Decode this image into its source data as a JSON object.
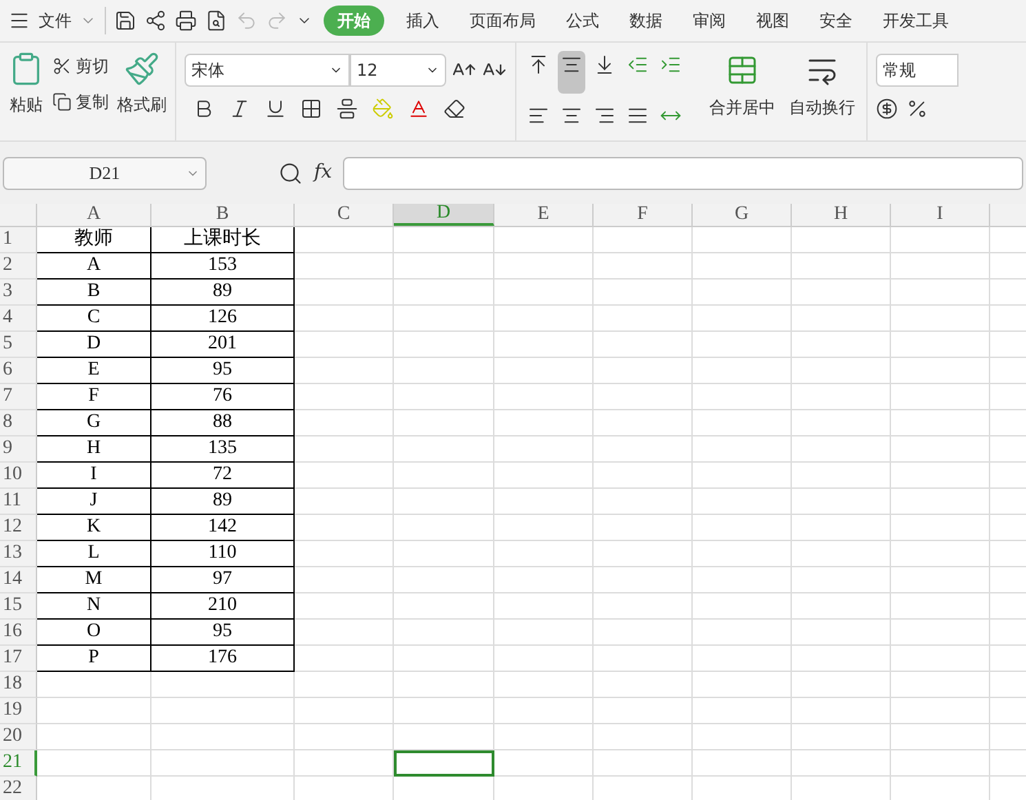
{
  "menu": {
    "file_label": "文件",
    "tabs": [
      {
        "label": "开始",
        "selected": true
      },
      {
        "label": "插入",
        "selected": false
      },
      {
        "label": "页面布局",
        "selected": false
      },
      {
        "label": "公式",
        "selected": false
      },
      {
        "label": "数据",
        "selected": false
      },
      {
        "label": "审阅",
        "selected": false
      },
      {
        "label": "视图",
        "selected": false
      },
      {
        "label": "安全",
        "selected": false
      },
      {
        "label": "开发工具",
        "selected": false
      }
    ]
  },
  "ribbon": {
    "paste": "粘贴",
    "cut": "剪切",
    "copy": "复制",
    "format_painter": "格式刷",
    "font_name": "宋体",
    "font_size": "12",
    "merge_center": "合并居中",
    "wrap_text": "自动换行",
    "number_format": "常规"
  },
  "formula_bar": {
    "name_box": "D21",
    "fx": "fx"
  },
  "sheet": {
    "columns": [
      {
        "label": "A",
        "selected": false
      },
      {
        "label": "B",
        "selected": false
      },
      {
        "label": "C",
        "selected": false
      },
      {
        "label": "D",
        "selected": true
      },
      {
        "label": "E",
        "selected": false
      },
      {
        "label": "F",
        "selected": false
      },
      {
        "label": "G",
        "selected": false
      },
      {
        "label": "H",
        "selected": false
      },
      {
        "label": "I",
        "selected": false
      }
    ],
    "rows": [
      {
        "label": "1",
        "selected": false,
        "cells": [
          "教师",
          "上课时长"
        ]
      },
      {
        "label": "2",
        "selected": false,
        "cells": [
          "A",
          "153"
        ]
      },
      {
        "label": "3",
        "selected": false,
        "cells": [
          "B",
          "89"
        ]
      },
      {
        "label": "4",
        "selected": false,
        "cells": [
          "C",
          "126"
        ]
      },
      {
        "label": "5",
        "selected": false,
        "cells": [
          "D",
          "201"
        ]
      },
      {
        "label": "6",
        "selected": false,
        "cells": [
          "E",
          "95"
        ]
      },
      {
        "label": "7",
        "selected": false,
        "cells": [
          "F",
          "76"
        ]
      },
      {
        "label": "8",
        "selected": false,
        "cells": [
          "G",
          "88"
        ]
      },
      {
        "label": "9",
        "selected": false,
        "cells": [
          "H",
          "135"
        ]
      },
      {
        "label": "10",
        "selected": false,
        "cells": [
          "I",
          "72"
        ]
      },
      {
        "label": "11",
        "selected": false,
        "cells": [
          "J",
          "89"
        ]
      },
      {
        "label": "12",
        "selected": false,
        "cells": [
          "K",
          "142"
        ]
      },
      {
        "label": "13",
        "selected": false,
        "cells": [
          "L",
          "110"
        ]
      },
      {
        "label": "14",
        "selected": false,
        "cells": [
          "M",
          "97"
        ]
      },
      {
        "label": "15",
        "selected": false,
        "cells": [
          "N",
          "210"
        ]
      },
      {
        "label": "16",
        "selected": false,
        "cells": [
          "O",
          "95"
        ]
      },
      {
        "label": "17",
        "selected": false,
        "cells": [
          "P",
          "176"
        ]
      },
      {
        "label": "18",
        "selected": false
      },
      {
        "label": "19",
        "selected": false
      },
      {
        "label": "20",
        "selected": false
      },
      {
        "label": "21",
        "selected": true
      },
      {
        "label": "22",
        "selected": false
      }
    ]
  }
}
